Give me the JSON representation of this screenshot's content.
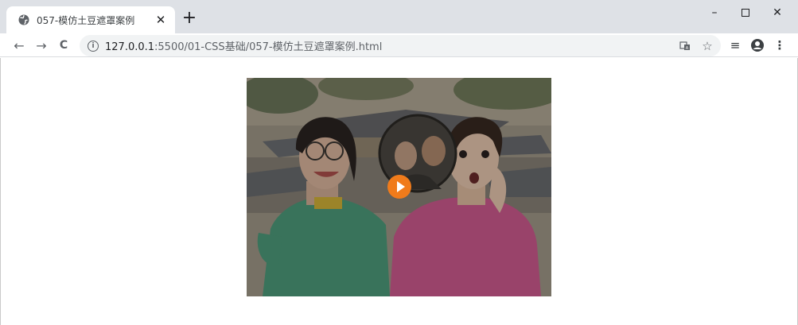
{
  "browser": {
    "tab": {
      "title": "057-模仿土豆遮罩案例",
      "close_glyph": "✕",
      "icon": "globe-icon"
    },
    "new_tab_glyph": "+",
    "window_controls": {
      "minimize": "–",
      "maximize": "☐",
      "close": "✕"
    },
    "nav": {
      "back": "←",
      "forward": "→",
      "reload": "C"
    },
    "address": {
      "host": "127.0.0.1",
      "path": ":5500/01-CSS基础/057-模仿土豆遮罩案例.html",
      "info_glyph": "i"
    },
    "toolbar_icons": {
      "translate": "translate-icon",
      "bookmark": "☆",
      "reading_list": "≡",
      "menu": "⋮"
    }
  },
  "page": {
    "video": {
      "play_button": "play-icon",
      "accent_color": "#f07b1b"
    }
  }
}
